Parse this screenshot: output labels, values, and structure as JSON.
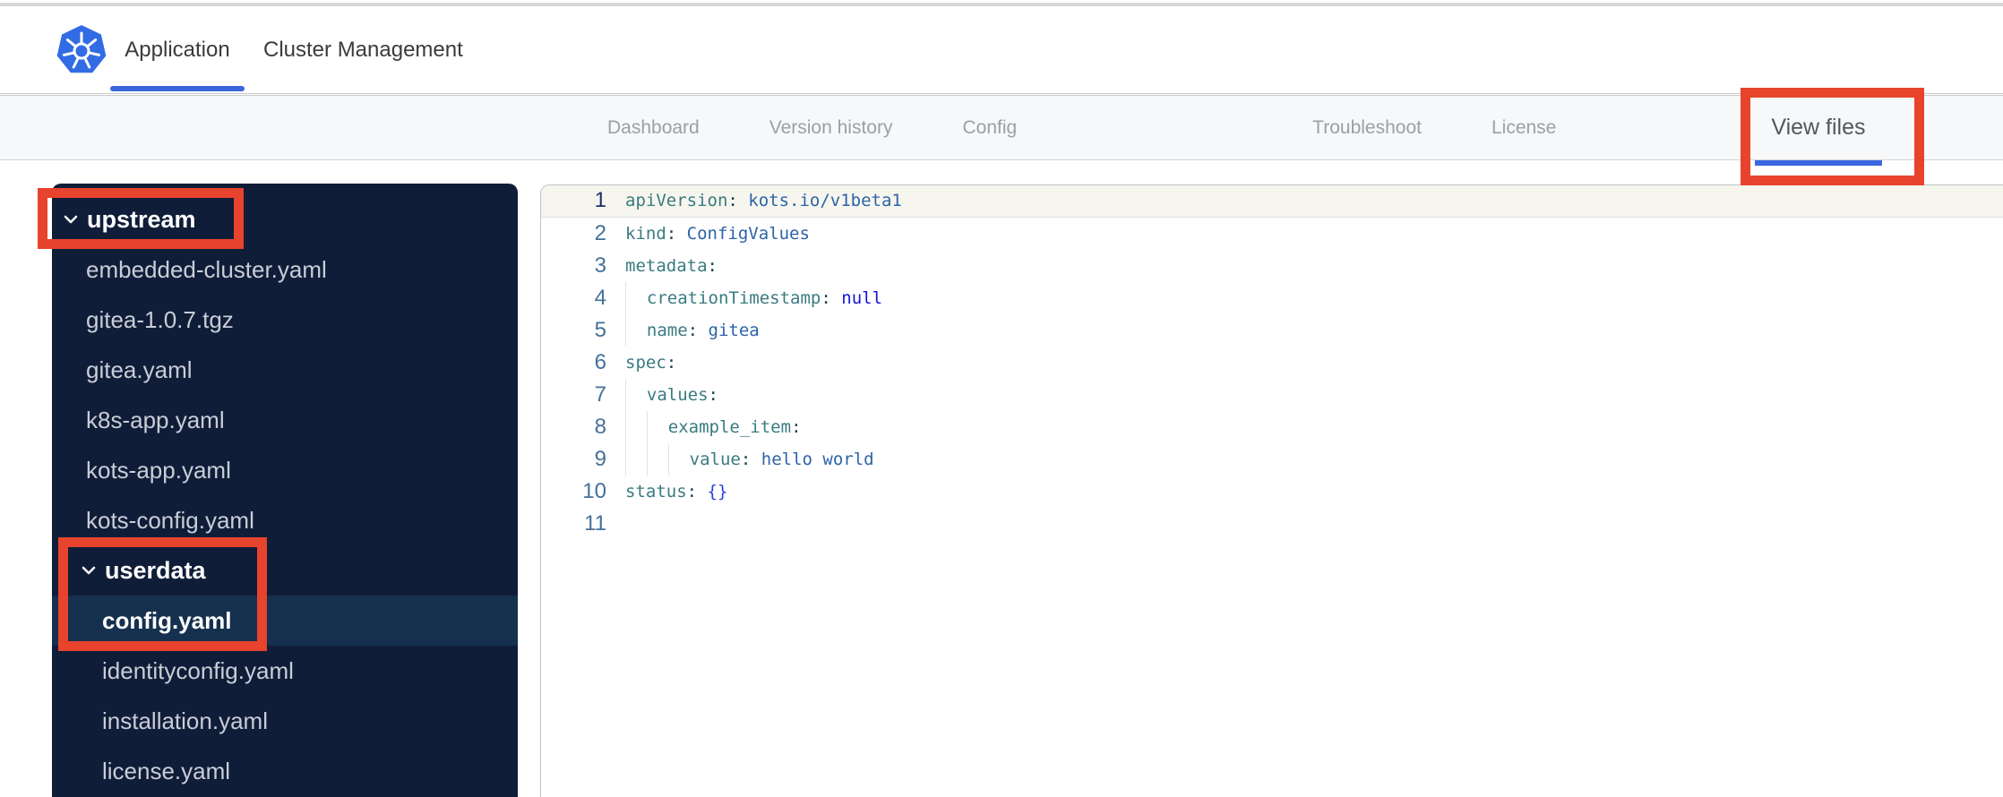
{
  "header": {
    "logo": "kubernetes-logo",
    "tabs": [
      {
        "label": "Application",
        "active": true
      },
      {
        "label": "Cluster Management",
        "active": false
      }
    ]
  },
  "navbar": {
    "tabs": [
      {
        "label": "Dashboard",
        "active": false
      },
      {
        "label": "Version history",
        "active": false
      },
      {
        "label": "Config",
        "active": false
      },
      {
        "label": "Troubleshoot",
        "active": false
      },
      {
        "label": "License",
        "active": false
      },
      {
        "label": "View files",
        "active": true
      }
    ]
  },
  "file_tree": {
    "items": [
      {
        "kind": "folder",
        "label": "upstream",
        "level": 0,
        "expanded": true,
        "selected": false
      },
      {
        "kind": "file",
        "label": "embedded-cluster.yaml",
        "level": 0,
        "selected": false
      },
      {
        "kind": "file",
        "label": "gitea-1.0.7.tgz",
        "level": 0,
        "selected": false
      },
      {
        "kind": "file",
        "label": "gitea.yaml",
        "level": 0,
        "selected": false
      },
      {
        "kind": "file",
        "label": "k8s-app.yaml",
        "level": 0,
        "selected": false
      },
      {
        "kind": "file",
        "label": "kots-app.yaml",
        "level": 0,
        "selected": false
      },
      {
        "kind": "file",
        "label": "kots-config.yaml",
        "level": 0,
        "selected": false
      },
      {
        "kind": "folder",
        "label": "userdata",
        "level": 1,
        "expanded": true,
        "selected": false
      },
      {
        "kind": "file",
        "label": "config.yaml",
        "level": 1,
        "selected": true
      },
      {
        "kind": "file",
        "label": "identityconfig.yaml",
        "level": 1,
        "selected": false
      },
      {
        "kind": "file",
        "label": "installation.yaml",
        "level": 1,
        "selected": false
      },
      {
        "kind": "file",
        "label": "license.yaml",
        "level": 1,
        "selected": false
      }
    ]
  },
  "editor": {
    "lines": [
      {
        "n": "1",
        "indent": 0,
        "tokens": [
          [
            "k",
            "apiVersion"
          ],
          [
            "p",
            ": "
          ],
          [
            "v",
            "kots.io/v1beta1"
          ]
        ]
      },
      {
        "n": "2",
        "indent": 0,
        "tokens": [
          [
            "k",
            "kind"
          ],
          [
            "p",
            ": "
          ],
          [
            "v",
            "ConfigValues"
          ]
        ]
      },
      {
        "n": "3",
        "indent": 0,
        "tokens": [
          [
            "k",
            "metadata"
          ],
          [
            "p",
            ":"
          ]
        ]
      },
      {
        "n": "4",
        "indent": 1,
        "tokens": [
          [
            "k",
            "creationTimestamp"
          ],
          [
            "p",
            ": "
          ],
          [
            "nu",
            "null"
          ]
        ]
      },
      {
        "n": "5",
        "indent": 1,
        "tokens": [
          [
            "k",
            "name"
          ],
          [
            "p",
            ": "
          ],
          [
            "v",
            "gitea"
          ]
        ]
      },
      {
        "n": "6",
        "indent": 0,
        "tokens": [
          [
            "k",
            "spec"
          ],
          [
            "p",
            ":"
          ]
        ]
      },
      {
        "n": "7",
        "indent": 1,
        "tokens": [
          [
            "k",
            "values"
          ],
          [
            "p",
            ":"
          ]
        ]
      },
      {
        "n": "8",
        "indent": 2,
        "tokens": [
          [
            "k",
            "example_item"
          ],
          [
            "p",
            ":"
          ]
        ]
      },
      {
        "n": "9",
        "indent": 3,
        "tokens": [
          [
            "k",
            "value"
          ],
          [
            "p",
            ": "
          ],
          [
            "v",
            "hello world"
          ]
        ]
      },
      {
        "n": "10",
        "indent": 0,
        "tokens": [
          [
            "k",
            "status"
          ],
          [
            "p",
            ": "
          ],
          [
            "b",
            "{}"
          ]
        ]
      },
      {
        "n": "11",
        "indent": 0,
        "tokens": []
      }
    ]
  },
  "annotations": {
    "color": "#e8432c",
    "boxes": [
      "view-files-tab",
      "upstream-folder",
      "userdata-and-config-yaml"
    ]
  },
  "colors": {
    "kubernetes_blue": "#326ce5",
    "tab_underline_blue": "#3a66db",
    "nav_underline_blue": "#3b68e0",
    "sidebar_bg": "#101d39",
    "selected_row_bg": "#16304f",
    "annotation_red": "#e8432c"
  }
}
